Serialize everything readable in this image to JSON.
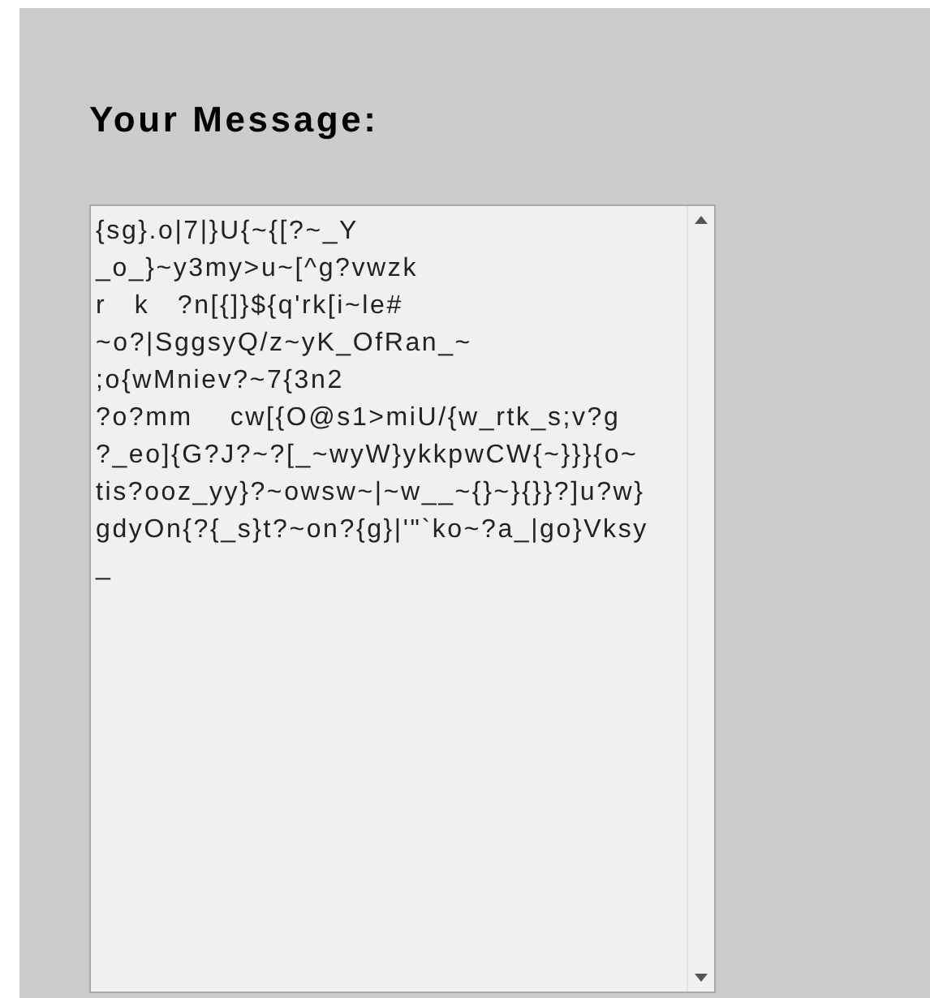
{
  "form": {
    "heading": "Your Message:",
    "message": {
      "value_lines": [
        "{sg}.o|7|}U{~{[?~_Y",
        "_o_}~y3my>u~[^g?vwzk",
        "r   k   ?n[{]}${q'rk[i~le#",
        "~o?|SggsyQ/z~yK_OfRan_~",
        ";o{wMniev?~7{3n2",
        "?o?mm    cw[{O@s1>miU/{w_rtk_s;v?g",
        "?_eo]{G?J?~?[_~wyW}ykkpwCW{~}}}{o~",
        "tis?ooz_yy}?~owsw~|~w__~{}~}{}}?]u?w}",
        "gdyOn{?{_s}t?~on?{g}|'\"`ko~?a_|go}Vksy",
        "_"
      ]
    }
  }
}
